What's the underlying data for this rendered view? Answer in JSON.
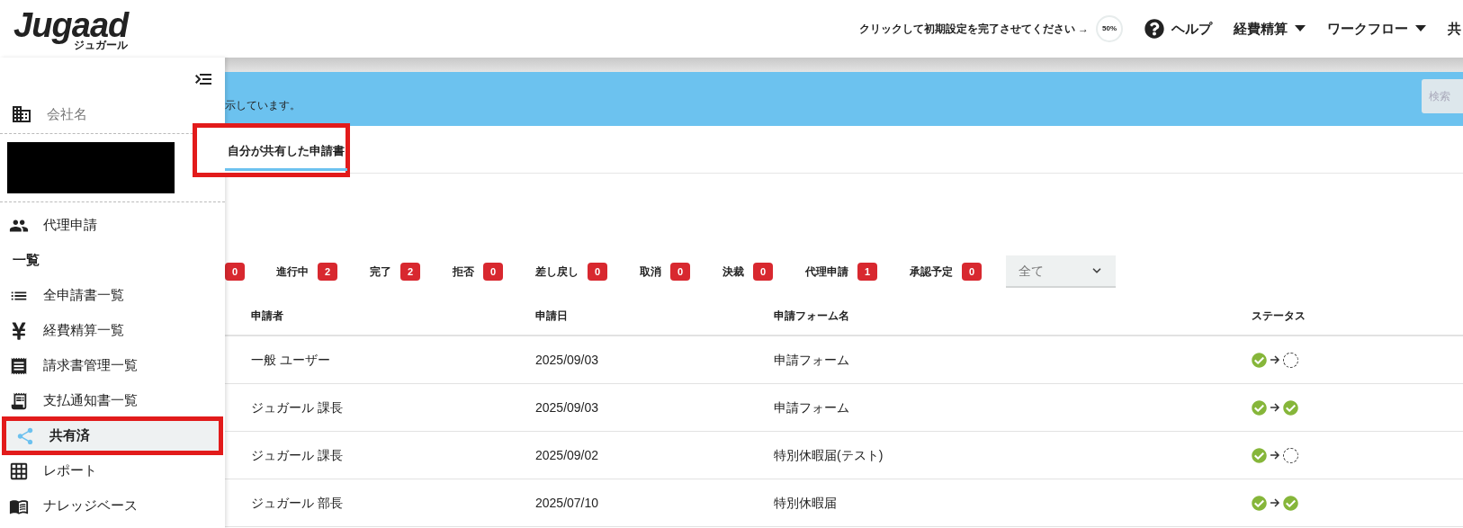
{
  "header": {
    "logo": "Jugaad",
    "logo_sub": "ジュガール",
    "setup_prompt": "クリックして初期設定を完了させてください →",
    "setup_progress": "50%",
    "nav": [
      {
        "label": "ヘルプ",
        "kind": "help"
      },
      {
        "label": "経費精算",
        "kind": "dropdown"
      },
      {
        "label": "ワークフロー",
        "kind": "dropdown"
      },
      {
        "label": "共",
        "kind": "cut"
      }
    ]
  },
  "sidebar": {
    "company_label": "会社名",
    "items": [
      {
        "label": "代理申請",
        "kind": "item",
        "selected": false,
        "highlighted": false
      },
      {
        "label": "一覧",
        "kind": "header"
      },
      {
        "label": "全申請書一覧",
        "kind": "item",
        "selected": false,
        "highlighted": false
      },
      {
        "label": "経費精算一覧",
        "kind": "item",
        "selected": false,
        "highlighted": false
      },
      {
        "label": "請求書管理一覧",
        "kind": "item",
        "selected": false,
        "highlighted": false
      },
      {
        "label": "支払通知書一覧",
        "kind": "item",
        "selected": false,
        "highlighted": false
      },
      {
        "label": "共有済",
        "kind": "item",
        "selected": true,
        "highlighted": true
      },
      {
        "label": "レポート",
        "kind": "item",
        "selected": false,
        "highlighted": false
      },
      {
        "label": "ナレッジベース",
        "kind": "item",
        "selected": false,
        "highlighted": false
      }
    ]
  },
  "banner": {
    "text": "示しています。",
    "search_button": "検索"
  },
  "tabs": [
    {
      "label": "自分が共有した申請書",
      "selected": true,
      "highlighted": true
    }
  ],
  "filters": [
    {
      "count": "0"
    },
    {
      "label": "進行中",
      "count": "2"
    },
    {
      "label": "完了",
      "count": "2"
    },
    {
      "label": "拒否",
      "count": "0"
    },
    {
      "label": "差し戻し",
      "count": "0"
    },
    {
      "label": "取消",
      "count": "0"
    },
    {
      "label": "決裁",
      "count": "0"
    },
    {
      "label": "代理申請",
      "count": "1"
    },
    {
      "label": "承認予定",
      "count": "0"
    }
  ],
  "filter_select": {
    "value": "全て"
  },
  "table": {
    "columns": [
      "申請者",
      "申請日",
      "申請フォーム名",
      "ステータス"
    ],
    "rows": [
      {
        "applicant": "一般 ユーザー",
        "date": "2025/09/03",
        "form": "申請フォーム",
        "steps": [
          {
            "done": true
          },
          {
            "done": false
          }
        ]
      },
      {
        "applicant": "ジュガール 課長",
        "date": "2025/09/03",
        "form": "申請フォーム",
        "steps": [
          {
            "done": true
          },
          {
            "done": true
          }
        ]
      },
      {
        "applicant": "ジュガール 課長",
        "date": "2025/09/02",
        "form": "特別休暇届(テスト)",
        "steps": [
          {
            "done": true
          },
          {
            "done": false
          }
        ]
      },
      {
        "applicant": "ジュガール 部長",
        "date": "2025/07/10",
        "form": "特別休暇届",
        "steps": [
          {
            "done": true
          },
          {
            "done": true
          }
        ]
      }
    ]
  }
}
